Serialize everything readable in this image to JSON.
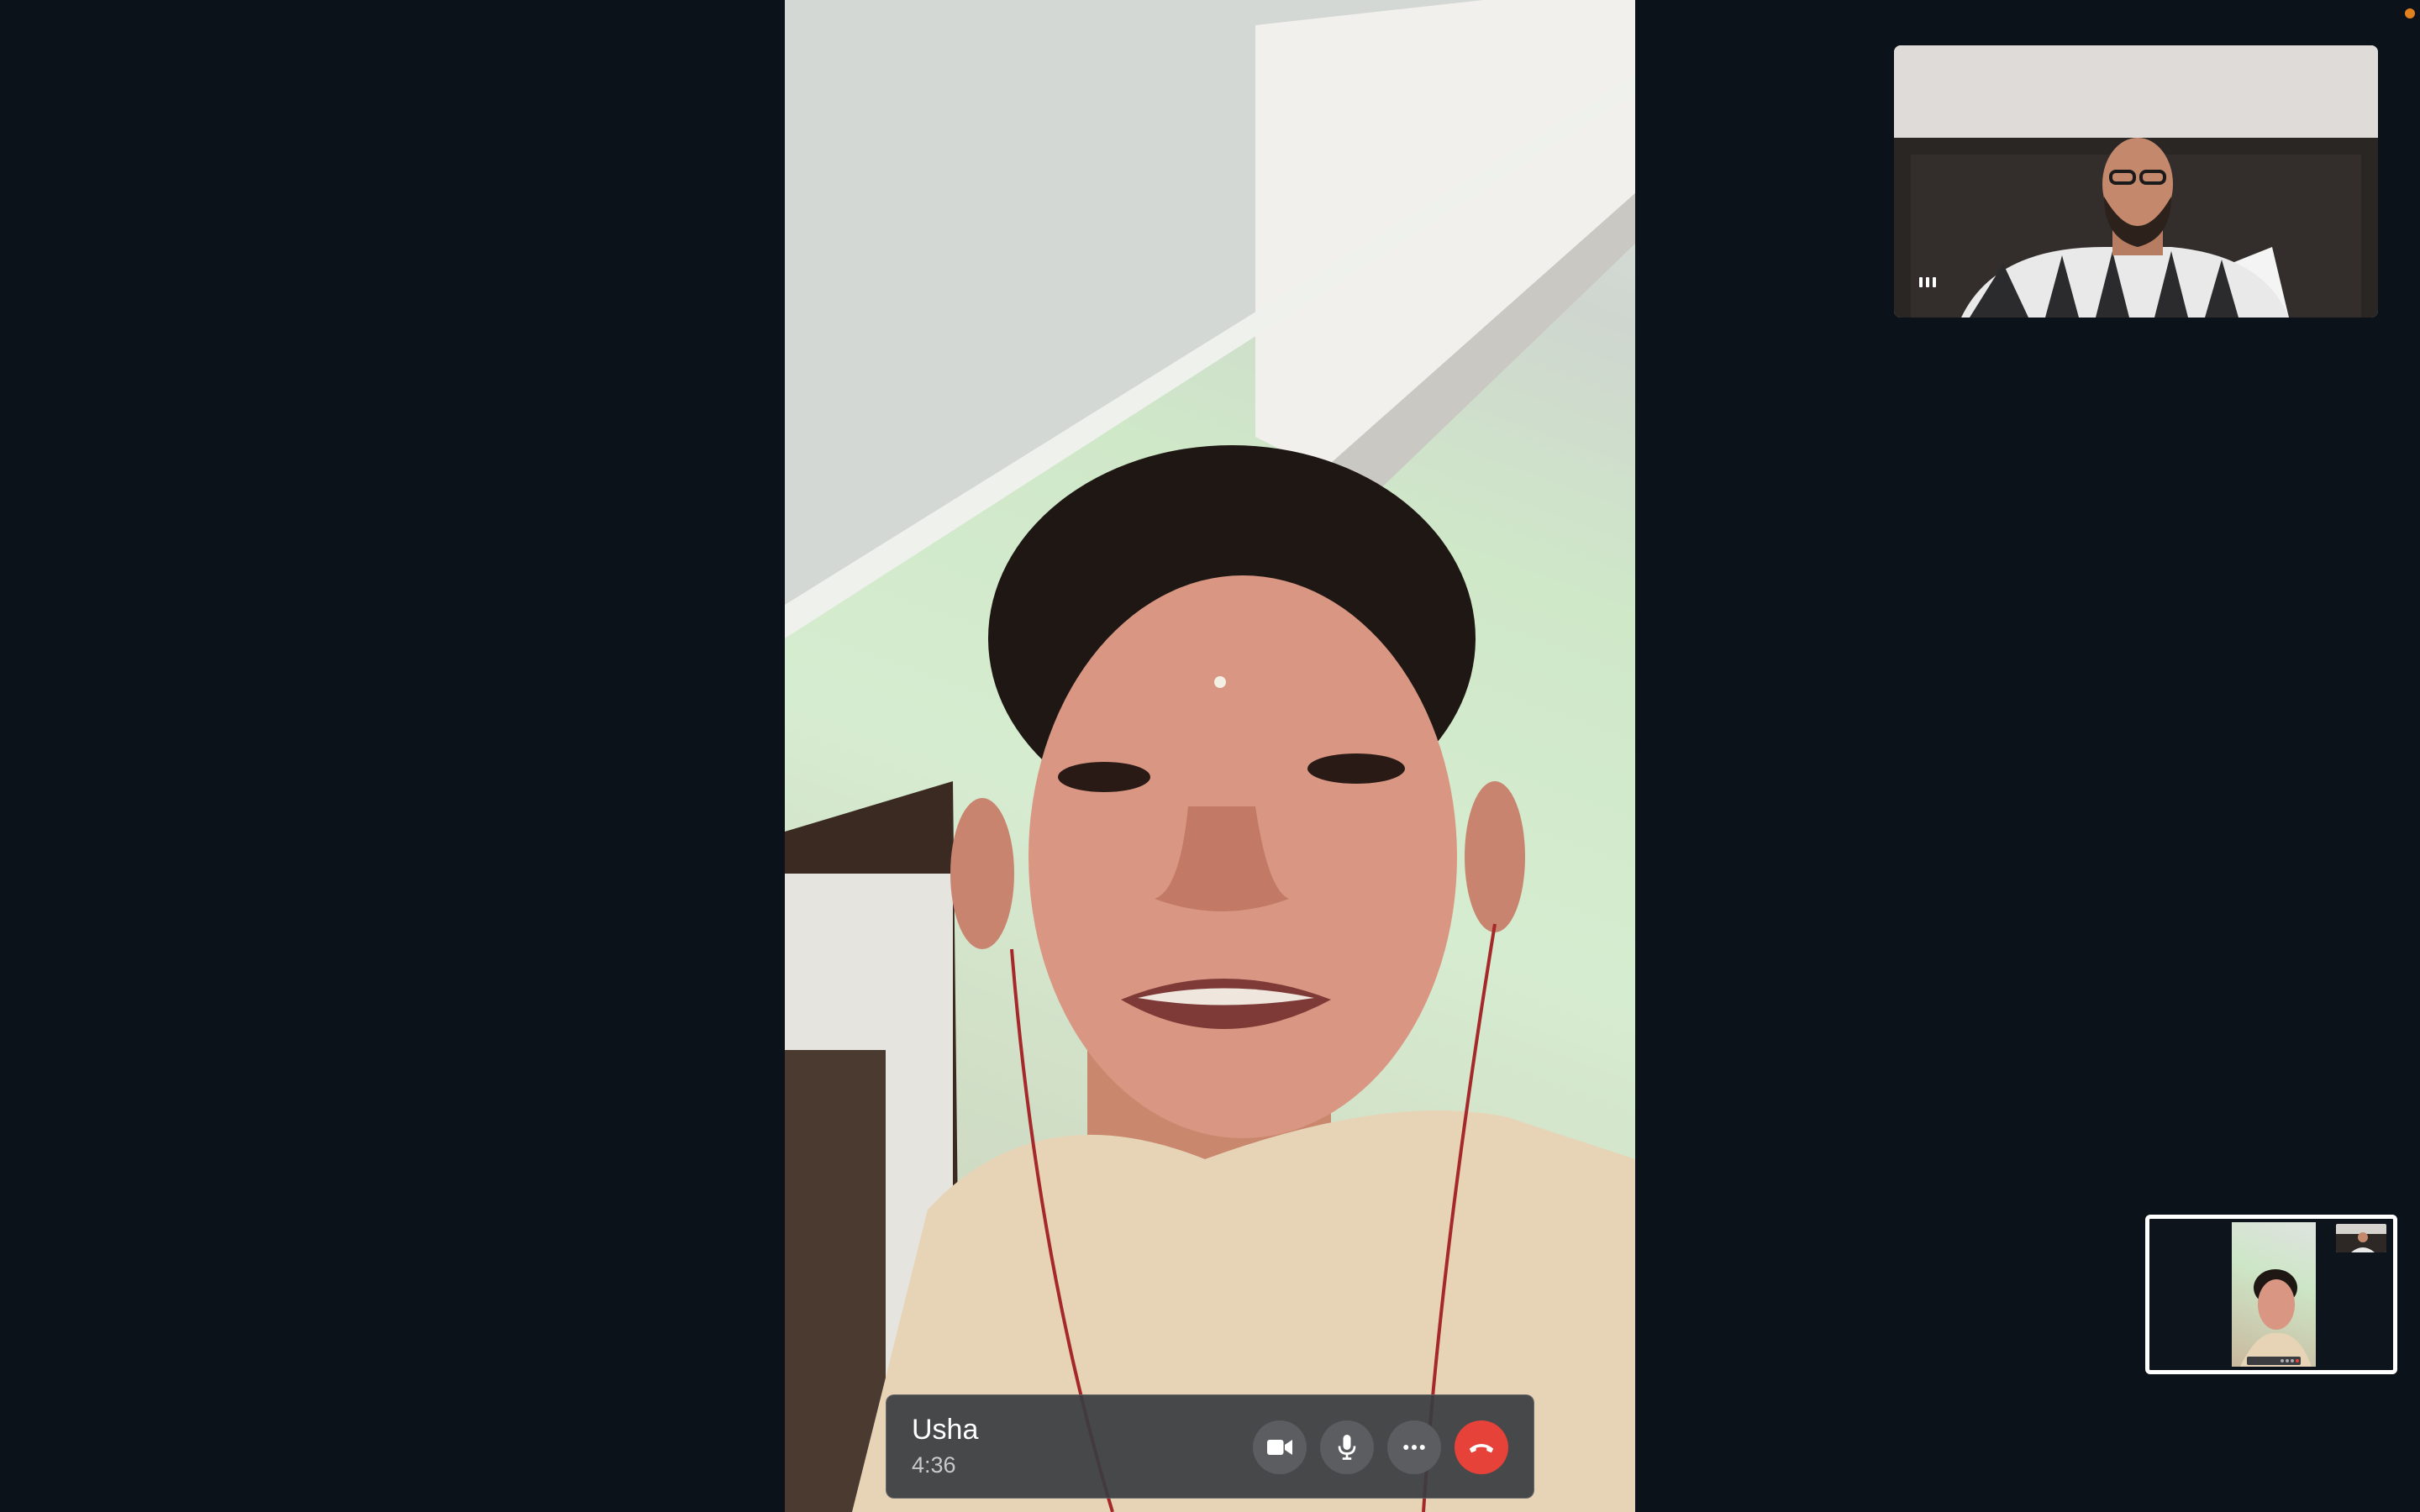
{
  "call": {
    "caller_name": "Usha",
    "duration": "4:36"
  },
  "controls": {
    "video": "video-camera-icon",
    "mic": "microphone-icon",
    "more": "more-options-icon",
    "end": "end-call-icon"
  },
  "colors": {
    "background": "#0b121a",
    "control_bar": "#3a3c40",
    "control_button": "#5b5d61",
    "end_call": "#e6423a",
    "status_dot": "#e0801e"
  }
}
